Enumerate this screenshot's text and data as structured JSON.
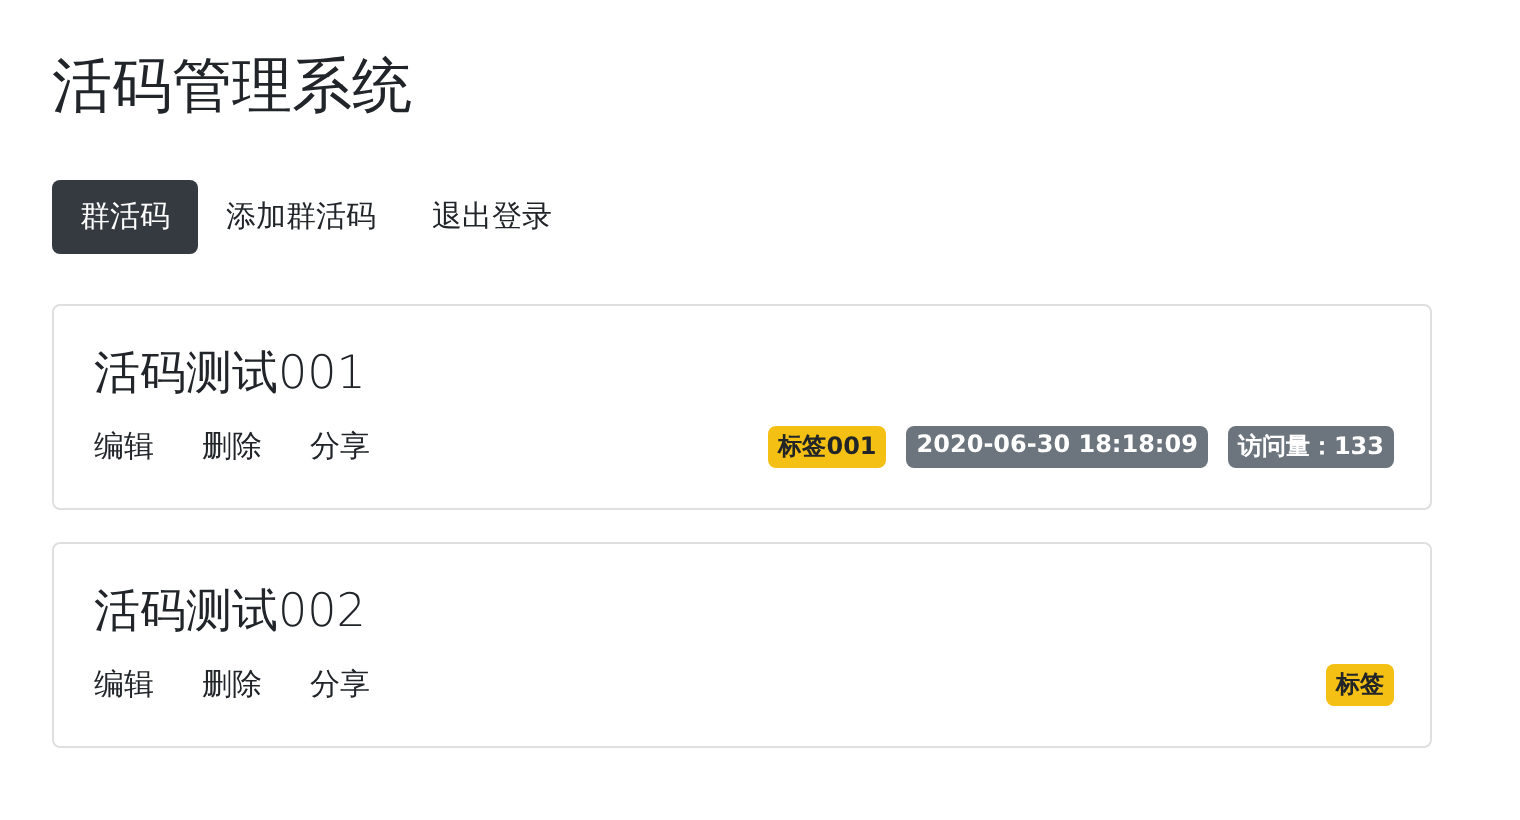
{
  "title": "活码管理系统",
  "nav": [
    {
      "label": "群活码",
      "selected": true
    },
    {
      "label": "添加群活码",
      "selected": false
    },
    {
      "label": "退出登录",
      "selected": false
    }
  ],
  "cards": [
    {
      "title": "活码测试001",
      "actions": [
        "编辑",
        "删除",
        "分享"
      ],
      "badges": [
        {
          "kind": "tag",
          "text": "标签001"
        },
        {
          "kind": "time",
          "text": "2020-06-30 18:18:09"
        },
        {
          "kind": "views",
          "text": "访问量：133"
        }
      ]
    },
    {
      "title": "活码测试002",
      "actions": [
        "编辑",
        "删除",
        "分享"
      ],
      "badges": [
        {
          "kind": "tag",
          "text": "标签"
        }
      ]
    }
  ]
}
